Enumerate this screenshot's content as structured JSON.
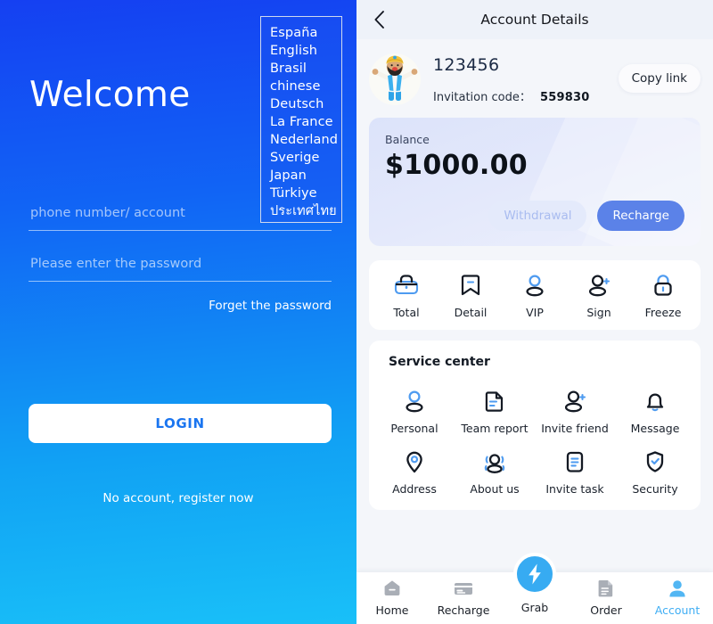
{
  "login": {
    "welcome_title": "Welcome",
    "languages": [
      "España",
      "English",
      "Brasil",
      "chinese",
      "Deutsch",
      "La France",
      "Nederland",
      "Sverige",
      "Japan",
      "Türkiye",
      "ประเทศไทย"
    ],
    "phone_placeholder": "phone number/ account",
    "phone_value": "",
    "password_placeholder": "Please enter the password",
    "password_value": "",
    "forget_password": "Forget the password",
    "login_button": "LOGIN",
    "register_link": "No account, register now",
    "gradient_top": "#1540F2",
    "gradient_bottom": "#19C0F8",
    "button_text_color": "#1A75F0"
  },
  "account": {
    "appbar": {
      "title": "Account Details",
      "back_icon": "chevron-left-icon"
    },
    "profile": {
      "avatar_icon": "user-avatar-illustration",
      "uid": "123456",
      "invitation_label": "Invitation code：",
      "invitation_code": "559830",
      "copy_link_button": "Copy link"
    },
    "balance": {
      "label": "Balance",
      "amount": "$1000.00",
      "withdrawal_button": "Withdrawal",
      "recharge_button": "Recharge",
      "recharge_color": "#5B82E8",
      "withdrawal_color": "#E4EAFB"
    },
    "quick_actions": [
      {
        "label": "Total",
        "icon": "briefcase-icon"
      },
      {
        "label": "Detail",
        "icon": "bookmark-minus-icon"
      },
      {
        "label": "VIP",
        "icon": "person-icon"
      },
      {
        "label": "Sign",
        "icon": "person-plus-icon"
      },
      {
        "label": "Freeze",
        "icon": "lock-icon"
      }
    ],
    "service_center": {
      "title": "Service center",
      "items": [
        {
          "label": "Personal",
          "icon": "person-icon"
        },
        {
          "label": "Team report",
          "icon": "document-lines-icon"
        },
        {
          "label": "Invite friend",
          "icon": "person-plus-icon"
        },
        {
          "label": "Message",
          "icon": "bell-icon"
        },
        {
          "label": "Address",
          "icon": "map-pin-icon"
        },
        {
          "label": "About us",
          "icon": "people-group-icon"
        },
        {
          "label": "Invite task",
          "icon": "task-list-icon"
        },
        {
          "label": "Security",
          "icon": "shield-check-icon"
        }
      ]
    },
    "bottom_nav": {
      "active": "Account",
      "active_color": "#3FAEF4",
      "items": [
        {
          "label": "Home",
          "icon": "home-icon"
        },
        {
          "label": "Recharge",
          "icon": "credit-card-icon"
        },
        {
          "label": "Grab",
          "icon": "lightning-bolt-icon"
        },
        {
          "label": "Order",
          "icon": "order-document-icon"
        },
        {
          "label": "Account",
          "icon": "account-person-icon"
        }
      ]
    }
  }
}
